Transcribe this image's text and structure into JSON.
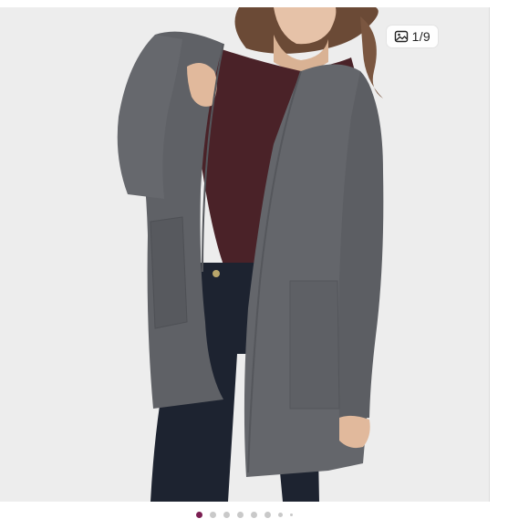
{
  "gallery": {
    "counter_text": "1/9",
    "counter_icon": "image-icon",
    "total_images": 9,
    "current_index": 1,
    "accent_color": "#7b1e52",
    "dot_color": "#c9c9c9"
  }
}
